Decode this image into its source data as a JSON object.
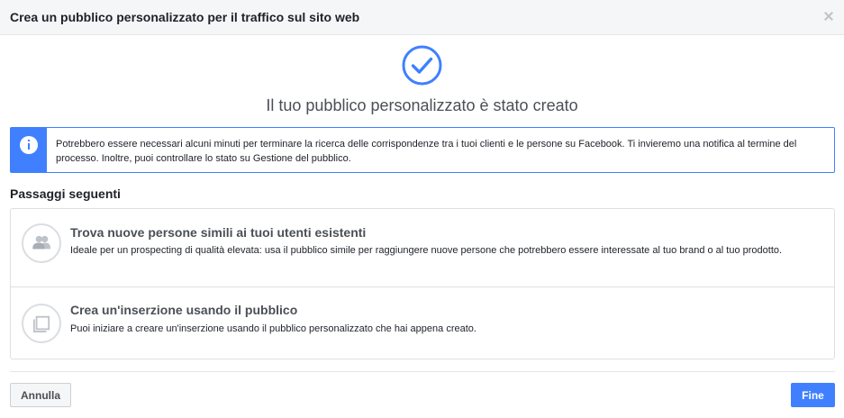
{
  "dialog": {
    "title": "Crea un pubblico personalizzato per il traffico sul sito web",
    "close_icon": "close-icon"
  },
  "success": {
    "icon": "checkmark-circle-icon",
    "title": "Il tuo pubblico personalizzato è stato creato"
  },
  "info": {
    "icon": "info-icon",
    "text": "Potrebbero essere necessari alcuni minuti per terminare la ricerca delle corrispondenze tra i tuoi clienti e le persone su Facebook. Ti invieremo una notifica al termine del processo. Inoltre, puoi controllare lo stato su Gestione del pubblico."
  },
  "next_steps": {
    "heading": "Passaggi seguenti",
    "items": [
      {
        "icon": "people-icon",
        "title": "Trova nuove persone simili ai tuoi utenti esistenti",
        "description": "Ideale per un prospecting di qualità elevata: usa il pubblico simile per raggiungere nuove persone che potrebbero essere interessate al tuo brand o al tuo prodotto."
      },
      {
        "icon": "ad-copy-icon",
        "title": "Crea un'inserzione usando il pubblico",
        "description": "Puoi iniziare a creare un'inserzione usando il pubblico personalizzato che hai appena creato."
      }
    ]
  },
  "footer": {
    "cancel_label": "Annulla",
    "done_label": "Fine"
  },
  "colors": {
    "accent": "#4080ff",
    "header_bg": "#f5f6f7",
    "border": "#dddfe2"
  }
}
